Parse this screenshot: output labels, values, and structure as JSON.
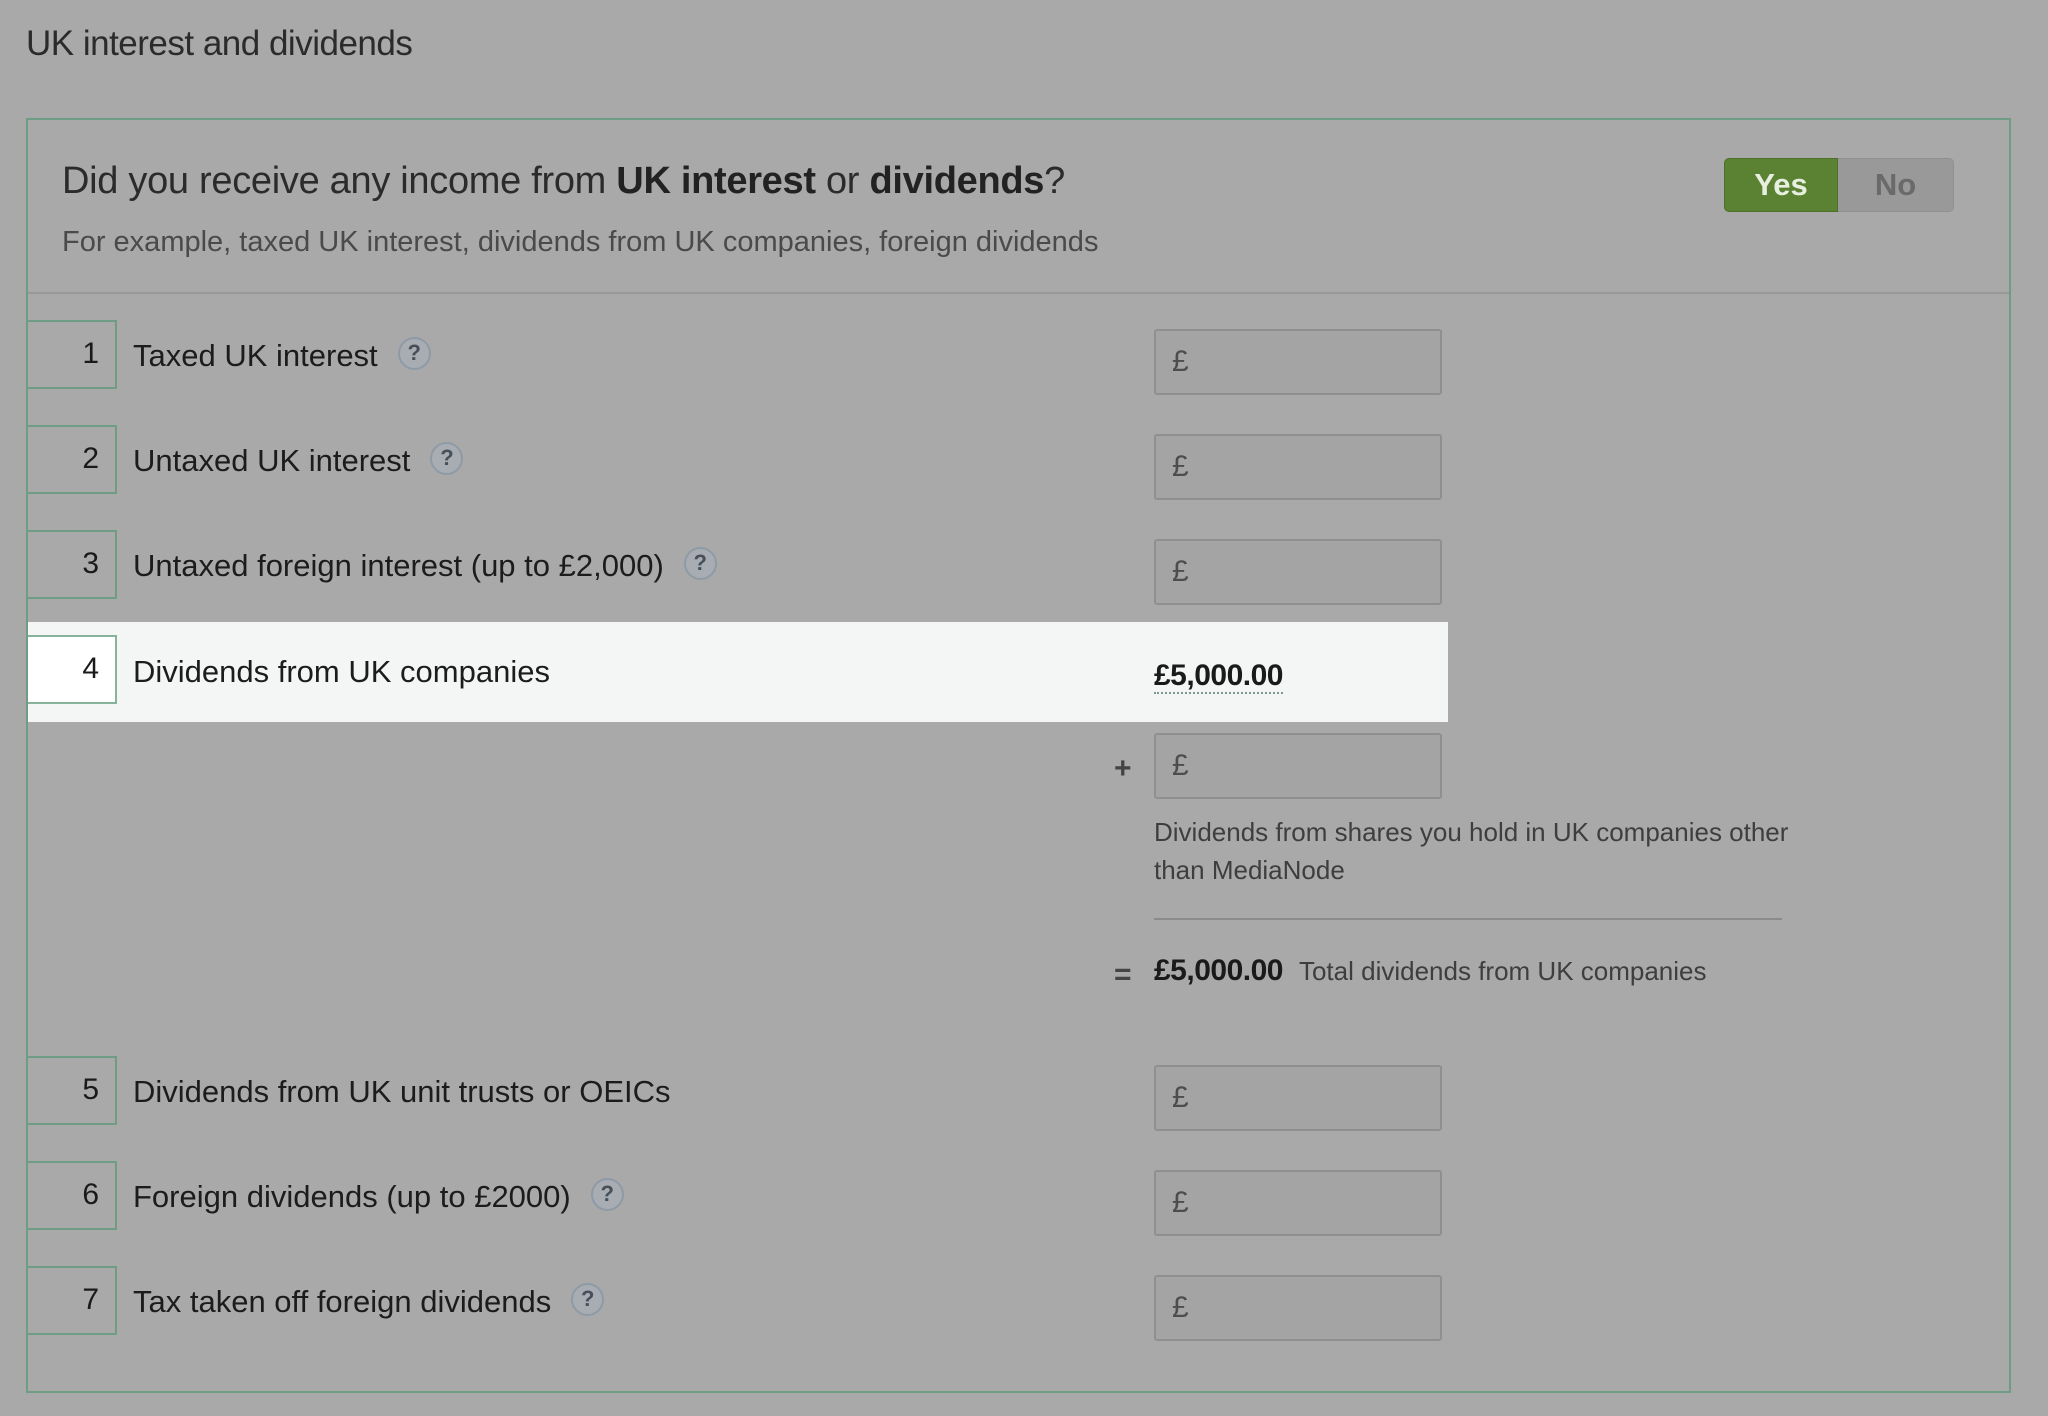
{
  "page_title": "UK interest and dividends",
  "question": {
    "prefix": "Did you receive any income from ",
    "bold1": "UK interest",
    "mid": " or ",
    "bold2": "dividends",
    "suffix": "?",
    "subtext": "For example, taxed UK interest, dividends from UK companies, foreign dividends",
    "toggle": {
      "yes_label": "Yes",
      "no_label": "No",
      "selected": "Yes"
    }
  },
  "currency_symbol": "£",
  "rows": [
    {
      "number": "1",
      "label": "Taxed UK interest",
      "has_help": true,
      "value": ""
    },
    {
      "number": "2",
      "label": "Untaxed UK interest",
      "has_help": true,
      "value": ""
    },
    {
      "number": "3",
      "label": "Untaxed foreign interest (up to £2,000)",
      "has_help": true,
      "value": ""
    },
    {
      "number": "4",
      "label": "Dividends from UK companies",
      "has_help": false,
      "amount": "£5,000.00"
    },
    {
      "number": "5",
      "label": "Dividends from UK unit trusts or OEICs",
      "has_help": false,
      "value": ""
    },
    {
      "number": "6",
      "label": "Foreign dividends (up to £2000)",
      "has_help": true,
      "value": ""
    },
    {
      "number": "7",
      "label": "Tax taken off foreign dividends",
      "has_help": true,
      "value": ""
    }
  ],
  "dividends_breakdown": {
    "plus_sign": "+",
    "other_value": "",
    "note": "Dividends from shares you hold in UK companies other than MediaNode",
    "equals_sign": "=",
    "total_amount": "£5,000.00",
    "total_label": "Total dividends from UK companies"
  },
  "help_glyph": "?",
  "colors": {
    "accent_green": "#5b8232",
    "panel_border": "#6f9c84",
    "overlay_gray": "#a9a9a9",
    "highlight_row": "#f3f6f5"
  }
}
